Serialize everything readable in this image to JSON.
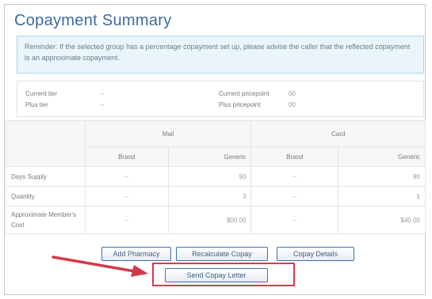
{
  "title": "Copayment Summary",
  "reminder": "Reminder: If the selected group has a percentage copayment set up, please advise the caller that the reflected copayment is an approximate copayment.",
  "tiers": {
    "current_tier_label": "Current tier",
    "current_tier_value": "--",
    "plus_tier_label": "Plus tier",
    "plus_tier_value": "--",
    "current_pricepoint_label": "Current pricepoint",
    "current_pricepoint_value": "00",
    "plus_pricepoint_label": "Plus pricepoint",
    "plus_pricepoint_value": "00"
  },
  "table": {
    "groups": [
      "Mail",
      "Card"
    ],
    "subheaders": [
      "Brand",
      "Generic",
      "Brand",
      "Generic"
    ],
    "rows": [
      {
        "label": "Days Supply",
        "values": [
          "--",
          "90",
          "--",
          "90"
        ]
      },
      {
        "label": "Quantity",
        "values": [
          "--",
          "3",
          "--",
          "1"
        ]
      },
      {
        "label": "Approximate Member's Cost",
        "values": [
          "--",
          "$00.00",
          "--",
          "$40.00"
        ]
      }
    ]
  },
  "buttons": {
    "add_pharmacy": "Add Pharmacy",
    "recalculate": "Recalculate Copay",
    "copay_details": "Copay Details",
    "send_letter": "Send Copay Letter"
  },
  "colors": {
    "title": "#3d6a9c",
    "reminder_bg": "#e9f4fb",
    "button_border": "#3b6fb1",
    "highlight": "#d23a4a",
    "arrow": "#d23a4a"
  }
}
